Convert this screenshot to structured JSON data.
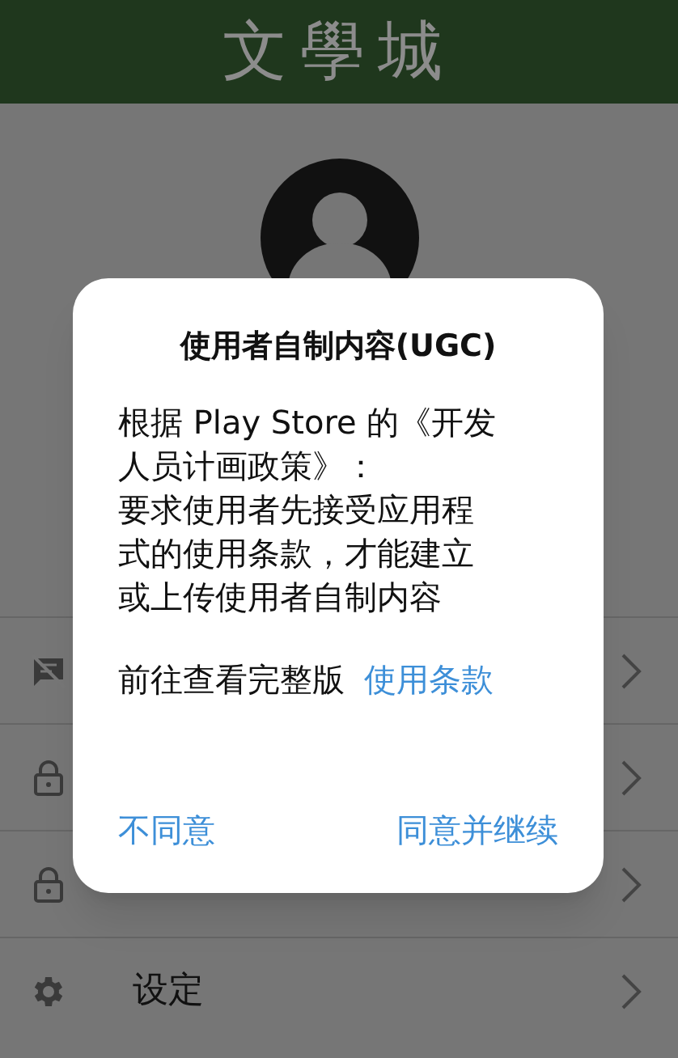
{
  "header": {
    "logo": "文學城"
  },
  "menu": [
    {
      "kind": "chat-off"
    },
    {
      "kind": "lock"
    },
    {
      "kind": "lock"
    },
    {
      "kind": "gear",
      "label": "设定"
    }
  ],
  "dialog": {
    "title": "使用者自制内容(UGC)",
    "body_lines": [
      "根据 Play Store 的《开发",
      "人员计画政策》：",
      "要求使用者先接受应用程",
      "式的使用条款，才能建立",
      "或上传使用者自制内容"
    ],
    "link_prefix": "前往查看完整版",
    "link": "使用条款",
    "buttons": [
      "不同意",
      "同意并继续"
    ]
  }
}
